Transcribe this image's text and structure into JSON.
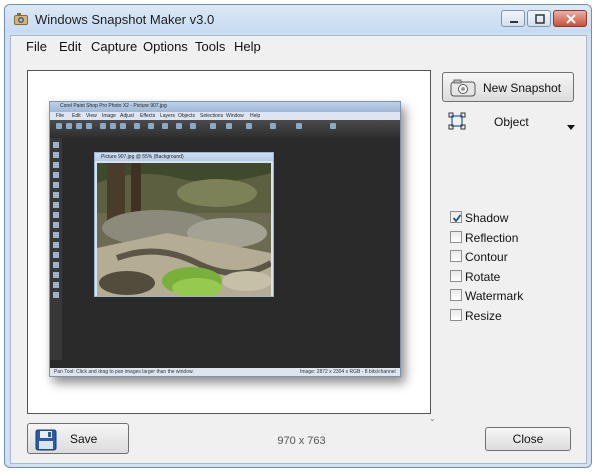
{
  "window": {
    "title": "Windows Snapshot Maker v3.0"
  },
  "menu": [
    "File",
    "Edit",
    "Capture",
    "Options",
    "Tools",
    "Help"
  ],
  "preview": {
    "embedded_title": "Corel Paint Shop Pro Photo X2 - Picture 907.jpg",
    "embedded_menu": [
      "File",
      "Edit",
      "View",
      "Image",
      "Adjust",
      "Effects",
      "Layers",
      "Objects",
      "Selections",
      "Window",
      "Help"
    ],
    "embedded_doc_title": "Picture 907.jpg @ 55% (Background)",
    "embedded_status_left": "Pan Tool: Click and drag to pan images larger than the window.",
    "embedded_status_right": "Image: 2872 x 2304 x RGB - 8 bits/channel"
  },
  "actions": {
    "new_snapshot": "New Snapshot",
    "capture_mode": "Object",
    "save": "Save",
    "close": "Close"
  },
  "options": [
    {
      "label": "Shadow",
      "checked": true
    },
    {
      "label": "Reflection",
      "checked": false
    },
    {
      "label": "Contour",
      "checked": false
    },
    {
      "label": "Rotate",
      "checked": false
    },
    {
      "label": "Watermark",
      "checked": false
    },
    {
      "label": "Resize",
      "checked": false
    }
  ],
  "dimensions": "970 x 763",
  "colors": {
    "frame": "#cfe0f3",
    "client": "#f0f0f0",
    "accent": "#3b6fb1"
  },
  "icons": {
    "app": "camera-app-icon",
    "new_snapshot": "camera-icon",
    "capture_mode": "object-select-icon",
    "save": "floppy-disk-icon"
  }
}
